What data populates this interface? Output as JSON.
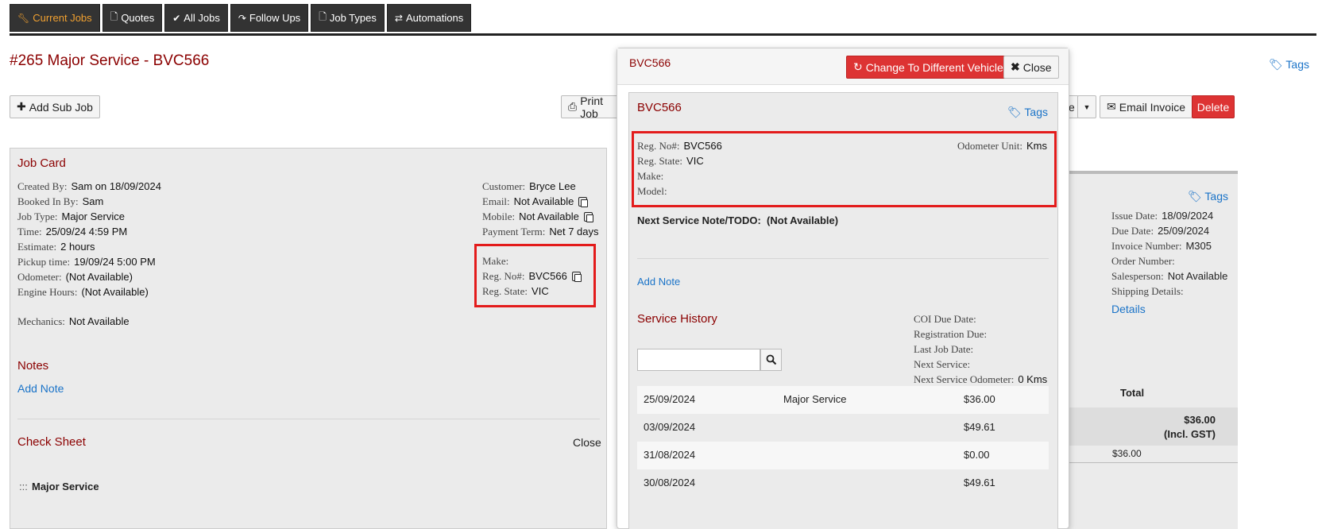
{
  "nav": {
    "tabs": [
      {
        "label": "Current Jobs",
        "icon": "wrench-icon",
        "active": true
      },
      {
        "label": "Quotes",
        "icon": "file-icon"
      },
      {
        "label": "All Jobs",
        "icon": "check-icon"
      },
      {
        "label": "Follow Ups",
        "icon": "share-icon"
      },
      {
        "label": "Job Types",
        "icon": "file-icon"
      },
      {
        "label": "Automations",
        "icon": "retweet-icon"
      }
    ]
  },
  "job": {
    "title": "#265 Major Service - BVC566",
    "tags_label": "Tags",
    "add_sub_job": "Add Sub Job",
    "print_job": "Print Job",
    "email_invoice": "Email Invoice",
    "delete": "Delete",
    "partial_btn": "e"
  },
  "job_card": {
    "title": "Job Card",
    "created_by": {
      "k": "Created By:",
      "v": "Sam on 18/09/2024"
    },
    "booked_in_by": {
      "k": "Booked In By:",
      "v": "Sam"
    },
    "job_type": {
      "k": "Job Type:",
      "v": "Major Service"
    },
    "time": {
      "k": "Time:",
      "v": "25/09/24 4:59 PM"
    },
    "estimate": {
      "k": "Estimate:",
      "v": "2 hours"
    },
    "pickup_time": {
      "k": "Pickup time:",
      "v": "19/09/24 5:00 PM"
    },
    "odometer": {
      "k": "Odometer:",
      "v": "(Not Available)"
    },
    "engine_hours": {
      "k": "Engine Hours:",
      "v": "(Not Available)"
    },
    "mechanics": {
      "k": "Mechanics:",
      "v": "Not Available"
    },
    "customer": {
      "k": "Customer:",
      "v": "Bryce Lee"
    },
    "email": {
      "k": "Email:",
      "v": "Not Available"
    },
    "mobile": {
      "k": "Mobile:",
      "v": "Not Available"
    },
    "payment_term": {
      "k": "Payment Term:",
      "v": "Net 7 days"
    },
    "make": {
      "k": "Make:",
      "v": ""
    },
    "reg_no": {
      "k": "Reg. No#:",
      "v": "BVC566"
    },
    "reg_state": {
      "k": "Reg. State:",
      "v": "VIC"
    },
    "notes_title": "Notes",
    "add_note": "Add Note",
    "check_sheet_title": "Check Sheet",
    "check_sheet_close": "Close",
    "check_sheet_item": "Major Service",
    "drag_handle": ":::"
  },
  "invoice_panel": {
    "tags_label": "Tags",
    "issue_date": {
      "k": "Issue Date:",
      "v": "18/09/2024"
    },
    "due_date": {
      "k": "Due Date:",
      "v": "25/09/2024"
    },
    "invoice_number": {
      "k": "Invoice Number:",
      "v": "M305"
    },
    "order_number": {
      "k": "Order Number:",
      "v": ""
    },
    "salesperson": {
      "k": "Salesperson:",
      "v": "Not Available"
    },
    "shipping_details": {
      "k": "Shipping Details:",
      "v": ""
    },
    "details_link": "Details",
    "total_header": "Total",
    "total_amount": "$36.00",
    "incl_gst": "(Incl. GST)",
    "line_amount": "$36.00"
  },
  "vehicle_modal": {
    "title": "BVC566",
    "change_vehicle": "Change To Different Vehicle",
    "close": "Close",
    "inner_title": "BVC566",
    "tags_label": "Tags",
    "reg_no": {
      "k": "Reg. No#:",
      "v": "BVC566"
    },
    "reg_state": {
      "k": "Reg. State:",
      "v": "VIC"
    },
    "make": {
      "k": "Make:",
      "v": ""
    },
    "model": {
      "k": "Model:",
      "v": ""
    },
    "odometer_unit": {
      "k": "Odometer Unit:",
      "v": "Kms"
    },
    "next_service_note": "Next Service Note/TODO:",
    "next_service_note_value": "(Not Available)",
    "add_note": "Add Note",
    "service_history_title": "Service History",
    "coi_due": {
      "k": "COI Due Date:",
      "v": ""
    },
    "registration_due": {
      "k": "Registration Due:",
      "v": ""
    },
    "last_job_date": {
      "k": "Last Job Date:",
      "v": ""
    },
    "next_service": {
      "k": "Next Service:",
      "v": ""
    },
    "next_service_odometer": {
      "k": "Next Service Odometer:",
      "v": "0 Kms"
    },
    "search_placeholder": "",
    "history": [
      {
        "date": "25/09/2024",
        "type": "Major Service",
        "amount": "$36.00"
      },
      {
        "date": "03/09/2024",
        "type": "",
        "amount": "$49.61"
      },
      {
        "date": "31/08/2024",
        "type": "",
        "amount": "$0.00"
      },
      {
        "date": "30/08/2024",
        "type": "",
        "amount": "$49.61"
      }
    ]
  },
  "colors": {
    "accent_red": "#8b0000",
    "link_blue": "#1a73c8",
    "danger": "#d33333",
    "nav_bg": "#333333",
    "nav_active": "#f0a030",
    "highlight_box": "#e31b1b"
  }
}
